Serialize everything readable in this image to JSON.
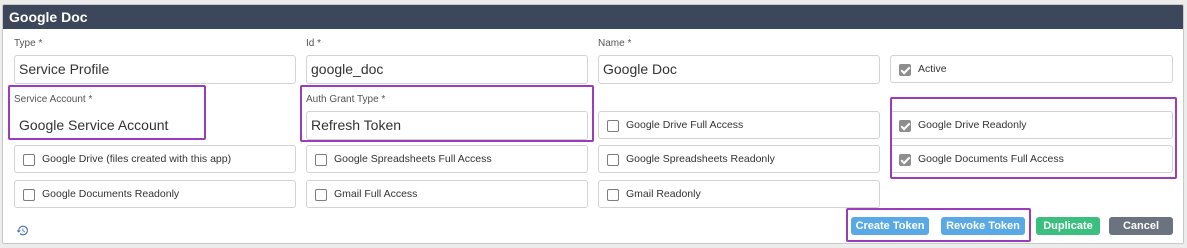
{
  "window": {
    "title": "Google Doc"
  },
  "fields": {
    "type": {
      "label": "Type *",
      "value": "Service Profile"
    },
    "id": {
      "label": "Id *",
      "value": "google_doc"
    },
    "name": {
      "label": "Name *",
      "value": "Google Doc"
    },
    "service_account": {
      "label": "Service Account *",
      "value": "Google Service Account"
    },
    "auth_grant_type": {
      "label": "Auth Grant Type *",
      "value": "Refresh Token"
    }
  },
  "checkboxes": {
    "active": {
      "label": "Active",
      "checked": true
    },
    "drive_full_access": {
      "label": "Google Drive Full Access",
      "checked": false
    },
    "drive_readonly": {
      "label": "Google Drive Readonly",
      "checked": true
    },
    "drive_files_created": {
      "label": "Google Drive (files created with this app)",
      "checked": false
    },
    "spreadsheets_full_access": {
      "label": "Google Spreadsheets Full Access",
      "checked": false
    },
    "spreadsheets_readonly": {
      "label": "Google Spreadsheets Readonly",
      "checked": false
    },
    "documents_full_access": {
      "label": "Google Documents Full Access",
      "checked": true
    },
    "documents_readonly": {
      "label": "Google Documents Readonly",
      "checked": false
    },
    "gmail_full_access": {
      "label": "Gmail Full Access",
      "checked": false
    },
    "gmail_readonly": {
      "label": "Gmail Readonly",
      "checked": false
    }
  },
  "footer": {
    "history_icon": "history-icon",
    "create_token": "Create Token",
    "revoke_token": "Revoke Token",
    "duplicate": "Duplicate",
    "cancel": "Cancel"
  },
  "colors": {
    "header_bg": "#3d475b",
    "highlight": "#9b3cbd",
    "button_blue": "#58a9e6",
    "button_green": "#3bbf7f",
    "button_gray": "#6b7280"
  }
}
